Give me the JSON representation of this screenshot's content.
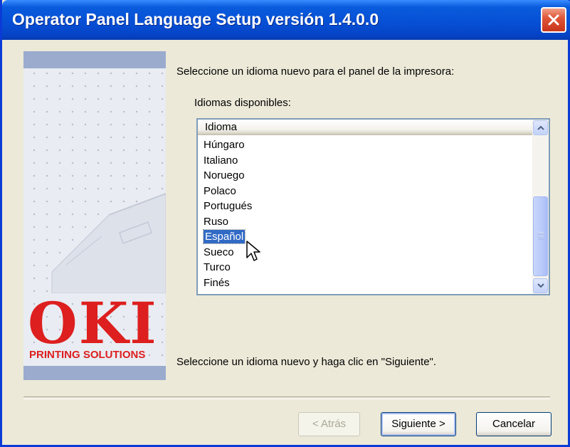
{
  "window": {
    "title": "Operator Panel Language Setup versión 1.4.0.0"
  },
  "banner": {
    "brand": "OKI",
    "tagline": "PRINTING SOLUTIONS"
  },
  "main": {
    "instruction": "Seleccione un idioma nuevo para el panel de la impresora:",
    "list_label": "Idiomas disponibles:",
    "column_header": "Idioma",
    "items": [
      "Húngaro",
      "Italiano",
      "Noruego",
      "Polaco",
      "Portugués",
      "Ruso",
      "Español",
      "Sueco",
      "Turco",
      "Finés"
    ],
    "selected": "Español",
    "footer_hint": "Seleccione un idioma nuevo y haga clic en \"Siguiente\"."
  },
  "buttons": {
    "back": "< Atrás",
    "next": "Siguiente >",
    "cancel": "Cancelar"
  },
  "colors": {
    "title_bar": "#0650d6",
    "selection": "#316ac5",
    "brand_red": "#dd1f1f"
  }
}
